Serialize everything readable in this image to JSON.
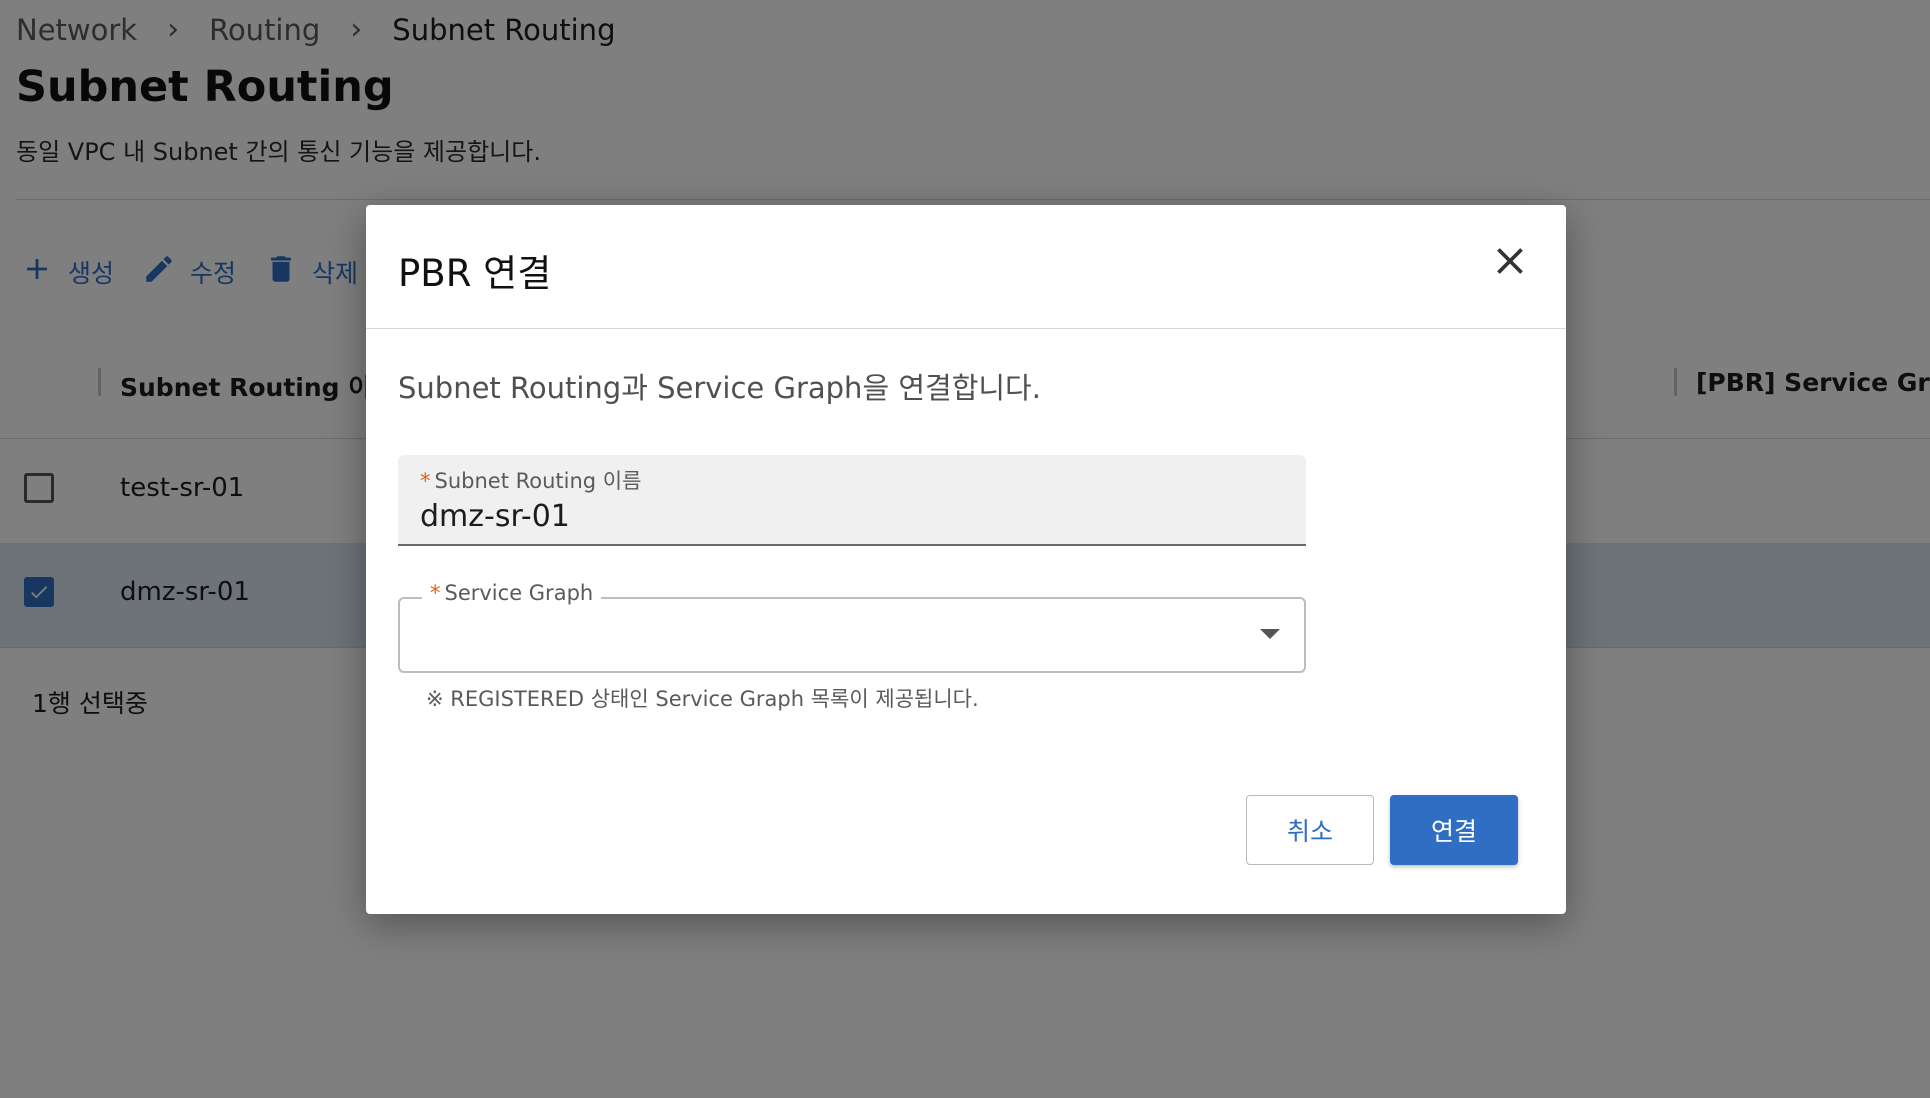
{
  "breadcrumb": {
    "items": [
      "Network",
      "Routing",
      "Subnet Routing"
    ],
    "separator": "›"
  },
  "page": {
    "title": "Subnet Routing",
    "description": "동일 VPC 내 Subnet 간의 통신 기능을 제공합니다."
  },
  "toolbar": {
    "create_label": "생성",
    "edit_label": "수정",
    "delete_label": "삭제"
  },
  "table": {
    "columns": [
      "Subnet Routing 이름",
      "[PBR] Service Graph"
    ],
    "rows": [
      {
        "name": "test-sr-01",
        "selected": false
      },
      {
        "name": "dmz-sr-01",
        "selected": true
      }
    ],
    "selection_count": "1행 선택중"
  },
  "modal": {
    "title": "PBR 연결",
    "description": "Subnet Routing과 Service Graph을 연결합니다.",
    "subnet_routing_field": {
      "required_mark": "*",
      "label": "Subnet Routing 이름",
      "value": "dmz-sr-01"
    },
    "service_graph_field": {
      "required_mark": "*",
      "label": "Service Graph",
      "value": ""
    },
    "helper_text": "※ REGISTERED 상태인 Service Graph 목록이 제공됩니다.",
    "cancel_label": "취소",
    "confirm_label": "연결"
  },
  "colors": {
    "accent": "#2f6ec3",
    "required": "#e0620c",
    "overlay": "rgba(0,0,0,0.5)"
  },
  "icons": [
    "plus-icon",
    "pencil-icon",
    "trash-icon",
    "close-icon",
    "check-icon",
    "dropdown-caret-icon"
  ]
}
